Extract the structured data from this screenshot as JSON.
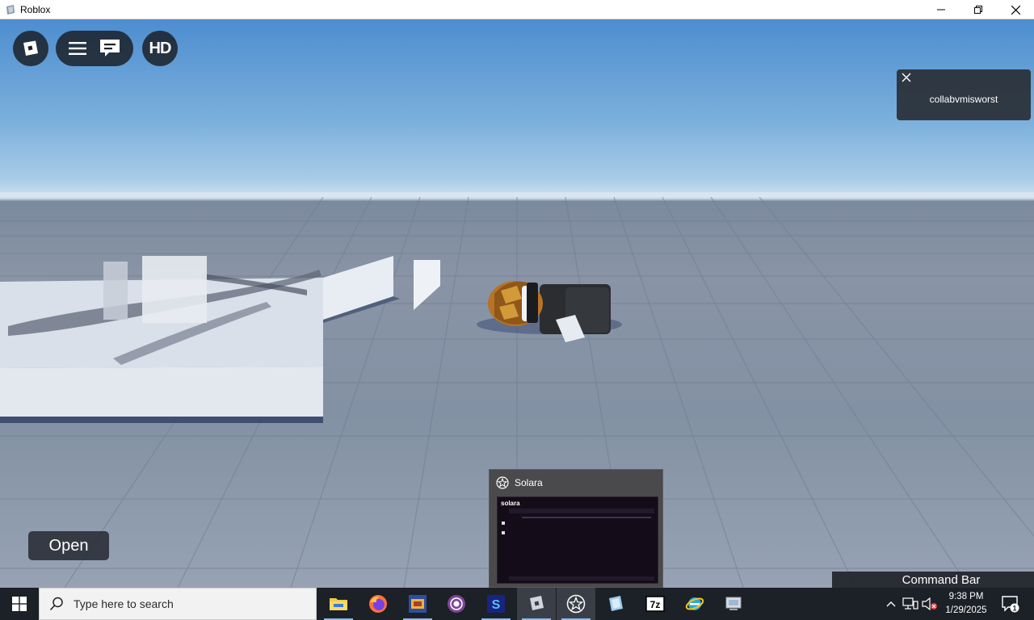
{
  "window": {
    "title": "Roblox"
  },
  "toast": {
    "message": "collabvmisworst"
  },
  "game": {
    "open_label": "Open",
    "command_bar_label": "Command Bar",
    "hd_label": "HD"
  },
  "preview": {
    "title": "Solara",
    "thumb_brand": "solara"
  },
  "taskbar": {
    "search_placeholder": "Type here to search",
    "time": "9:38 PM",
    "date": "1/29/2025",
    "notification_count": "1"
  }
}
